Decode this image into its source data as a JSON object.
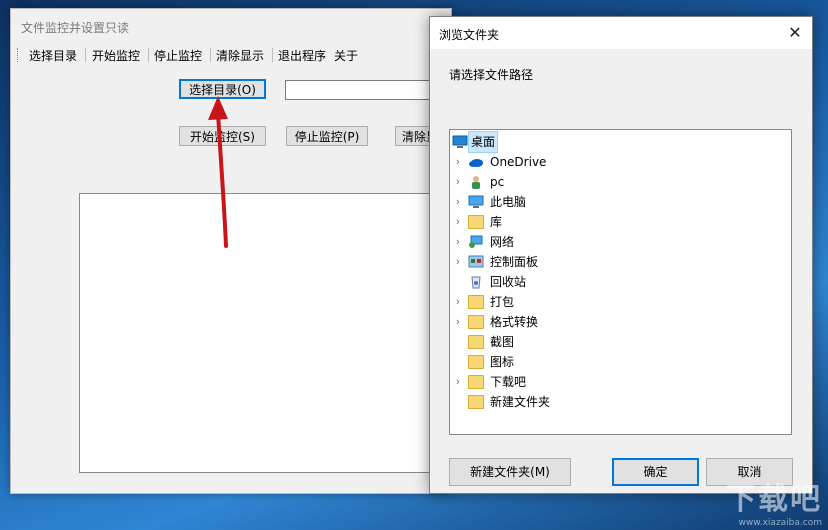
{
  "app": {
    "title": "文件监控并设置只读",
    "menu": [
      "选择目录",
      "开始监控",
      "停止监控",
      "清除显示",
      "退出程序",
      "关于"
    ],
    "buttons": {
      "select_dir": "选择目录(O)",
      "start": "开始监控(S)",
      "stop": "停止监控(P)",
      "clear": "清除显示"
    },
    "path_value": ""
  },
  "dialog": {
    "title": "浏览文件夹",
    "close": "✕",
    "prompt": "请选择文件路径",
    "tree": [
      {
        "label": "桌面",
        "icon": "desktop-icon",
        "expandable": false,
        "selected": true
      },
      {
        "label": "OneDrive",
        "icon": "cloud-icon",
        "expandable": true
      },
      {
        "label": "pc",
        "icon": "user-icon",
        "expandable": true
      },
      {
        "label": "此电脑",
        "icon": "computer-icon",
        "expandable": true
      },
      {
        "label": "库",
        "icon": "library-icon",
        "expandable": true
      },
      {
        "label": "网络",
        "icon": "network-icon",
        "expandable": true
      },
      {
        "label": "控制面板",
        "icon": "control-panel-icon",
        "expandable": true
      },
      {
        "label": "回收站",
        "icon": "recycle-bin-icon",
        "expandable": false
      },
      {
        "label": "打包",
        "icon": "folder-icon",
        "expandable": true
      },
      {
        "label": "格式转换",
        "icon": "folder-icon",
        "expandable": true
      },
      {
        "label": "截图",
        "icon": "folder-icon",
        "expandable": false
      },
      {
        "label": "图标",
        "icon": "folder-icon",
        "expandable": false
      },
      {
        "label": "下载吧",
        "icon": "folder-icon",
        "expandable": true
      },
      {
        "label": "新建文件夹",
        "icon": "folder-icon",
        "expandable": false
      }
    ],
    "buttons": {
      "new_folder": "新建文件夹(M)",
      "ok": "确定",
      "cancel": "取消"
    }
  },
  "watermark": {
    "text": "下载吧",
    "sub": "www.xiazaiba.com"
  },
  "colors": {
    "accent": "#0078d7",
    "arrow": "#c8151b",
    "selection": "#cce8ff"
  }
}
